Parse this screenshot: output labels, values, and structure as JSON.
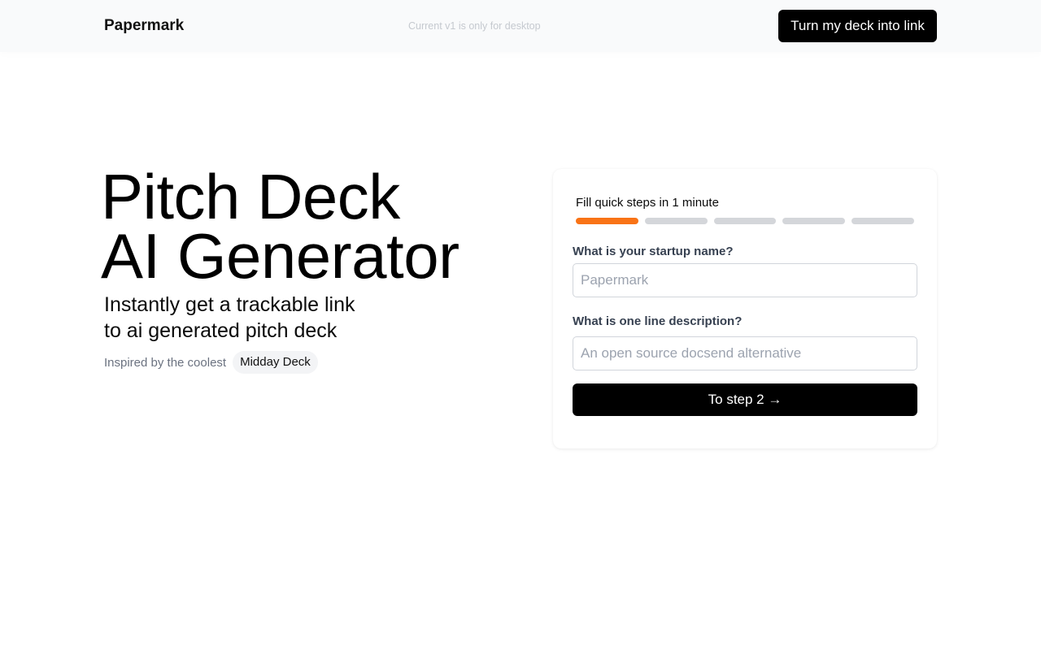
{
  "header": {
    "brand": "Papermark",
    "notice": "Current v1 is only for desktop",
    "cta_label": "Turn my deck into link"
  },
  "hero": {
    "title_line1": "Pitch Deck",
    "title_line2": "AI Generator",
    "subtitle_line1": "Instantly get a trackable link",
    "subtitle_line2": "to ai generated pitch deck",
    "inspired_text": "Inspired by the coolest",
    "inspired_link": "Midday Deck"
  },
  "form": {
    "steps_label": "Fill quick steps in 1 minute",
    "steps": [
      {
        "active": true
      },
      {
        "active": false
      },
      {
        "active": false
      },
      {
        "active": false
      },
      {
        "active": false
      }
    ],
    "current_step": 1,
    "total_steps": 5,
    "startup_name_label": "What is your startup name?",
    "startup_name_placeholder": "Papermark",
    "startup_name_value": "",
    "description_label": "What is one line description?",
    "description_placeholder": "An open source docsend alternative",
    "description_value": "",
    "submit_label": "To step 2 →"
  },
  "colors": {
    "accent": "#f97316",
    "step_inactive": "#d4d6da",
    "button_bg": "#000000",
    "button_text": "#ffffff"
  }
}
